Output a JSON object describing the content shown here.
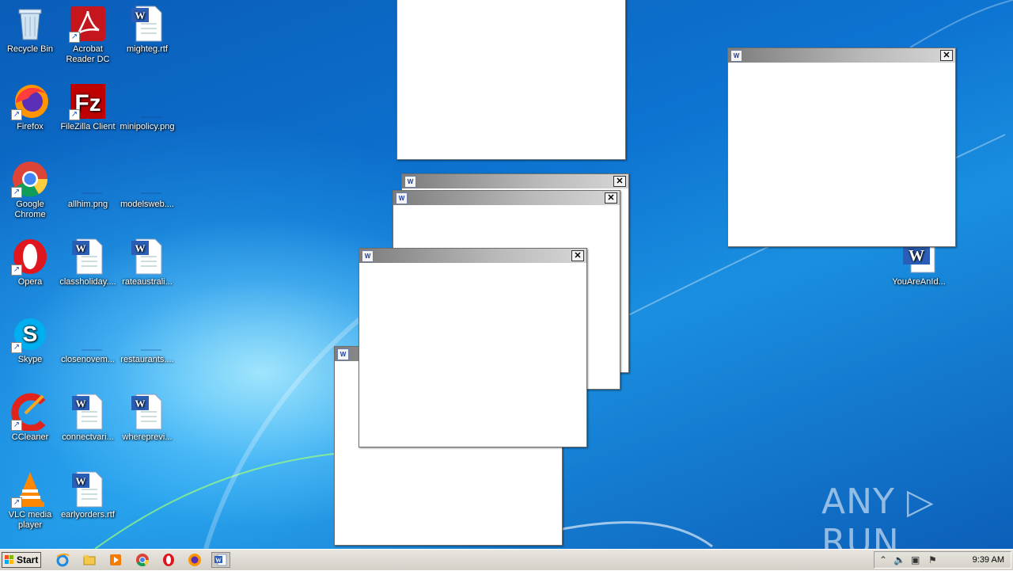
{
  "desktop": {
    "icons": [
      {
        "label": "Recycle Bin",
        "icon": "recycle-bin-icon"
      },
      {
        "label": "Acrobat Reader DC",
        "icon": "acrobat-icon"
      },
      {
        "label": "mighteg.rtf",
        "icon": "word-doc-icon"
      },
      {
        "label": "Firefox",
        "icon": "firefox-icon"
      },
      {
        "label": "FileZilla Client",
        "icon": "filezilla-icon"
      },
      {
        "label": "minipolicy.png",
        "icon": "png-file-icon"
      },
      {
        "label": "Google Chrome",
        "icon": "chrome-icon"
      },
      {
        "label": "allhim.png",
        "icon": "png-file-icon"
      },
      {
        "label": "modelsweb....",
        "icon": "png-file-icon"
      },
      {
        "label": "Opera",
        "icon": "opera-icon"
      },
      {
        "label": "classholiday....",
        "icon": "word-doc-icon"
      },
      {
        "label": "rateaustrali...",
        "icon": "word-doc-icon"
      },
      {
        "label": "Skype",
        "icon": "skype-icon"
      },
      {
        "label": "closenovem...",
        "icon": "png-file-icon"
      },
      {
        "label": "restaurants....",
        "icon": "png-file-icon"
      },
      {
        "label": "CCleaner",
        "icon": "ccleaner-icon"
      },
      {
        "label": "connectvari...",
        "icon": "word-doc-icon"
      },
      {
        "label": "whereprevi...",
        "icon": "word-doc-icon"
      },
      {
        "label": "VLC media player",
        "icon": "vlc-icon"
      },
      {
        "label": "earlyorders.rtf",
        "icon": "word-doc-icon"
      },
      {
        "label": "YouAreAnId...",
        "icon": "word-doc-icon"
      }
    ]
  },
  "windows": {
    "close_glyph": "✕",
    "icon_glyph": "W"
  },
  "taskbar": {
    "start_label": "Start",
    "clock": "9:39 AM",
    "programs": [
      "internet-explorer-icon",
      "explorer-icon",
      "media-player-icon",
      "chrome-icon",
      "opera-icon",
      "firefox-icon",
      "word-icon"
    ]
  },
  "watermark": "ANY ▷ RUN"
}
